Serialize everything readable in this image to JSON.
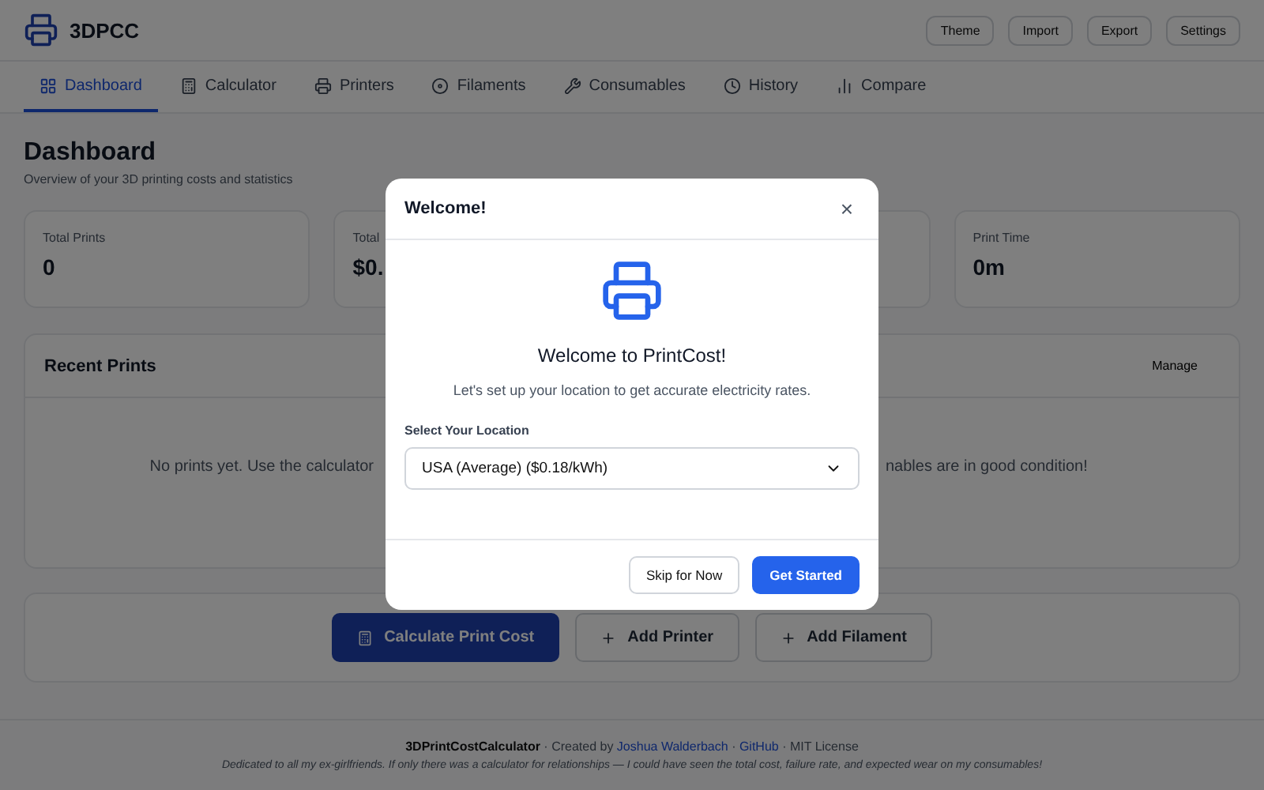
{
  "header": {
    "logo": "3DPCC",
    "buttons": [
      "Theme",
      "Import",
      "Export",
      "Settings"
    ]
  },
  "tabs": [
    {
      "label": "Dashboard",
      "selected": true
    },
    {
      "label": "Calculator",
      "selected": false
    },
    {
      "label": "Printers",
      "selected": false
    },
    {
      "label": "Filaments",
      "selected": false
    },
    {
      "label": "Consumables",
      "selected": false
    },
    {
      "label": "History",
      "selected": false
    },
    {
      "label": "Compare",
      "selected": false
    }
  ],
  "page": {
    "title": "Dashboard",
    "subtitle": "Overview of your 3D printing costs and statistics"
  },
  "stats": [
    {
      "label": "Total Prints",
      "value": "0"
    },
    {
      "label": "Total",
      "value": "$0."
    },
    {
      "label": "Print Time",
      "value": "0m"
    }
  ],
  "recent_prints": {
    "title": "Recent Prints",
    "message": "No prints yet. Use the calculator"
  },
  "consumables_panel": {
    "action": "Manage",
    "message": "nables are in good condition!"
  },
  "actions": [
    {
      "label": "Calculate Print Cost",
      "primary": true
    },
    {
      "label": "Add Printer",
      "primary": false
    },
    {
      "label": "Add Filament",
      "primary": false
    }
  ],
  "footer": {
    "app": "3DPrintCostCalculator",
    "created": " · Created by ",
    "author": "Joshua Walderbach",
    "sep": " · ",
    "github": "GitHub",
    "license": " · MIT License",
    "dedication": "Dedicated to all my ex-girlfriends. If only there was a calculator for relationships — I could have seen the total cost, failure rate, and expected wear on my consumables!"
  },
  "dialog": {
    "title": "Welcome!",
    "close": "×",
    "heading": "Welcome to PrintCost!",
    "text": "Let's set up your location to get accurate electricity rates.",
    "select_label": "Select Your Location",
    "select_value": "USA (Average) ($0.18/kWh)",
    "buttons": [
      {
        "label": "Skip for Now",
        "primary": false
      },
      {
        "label": "Get Started",
        "primary": true
      }
    ]
  }
}
